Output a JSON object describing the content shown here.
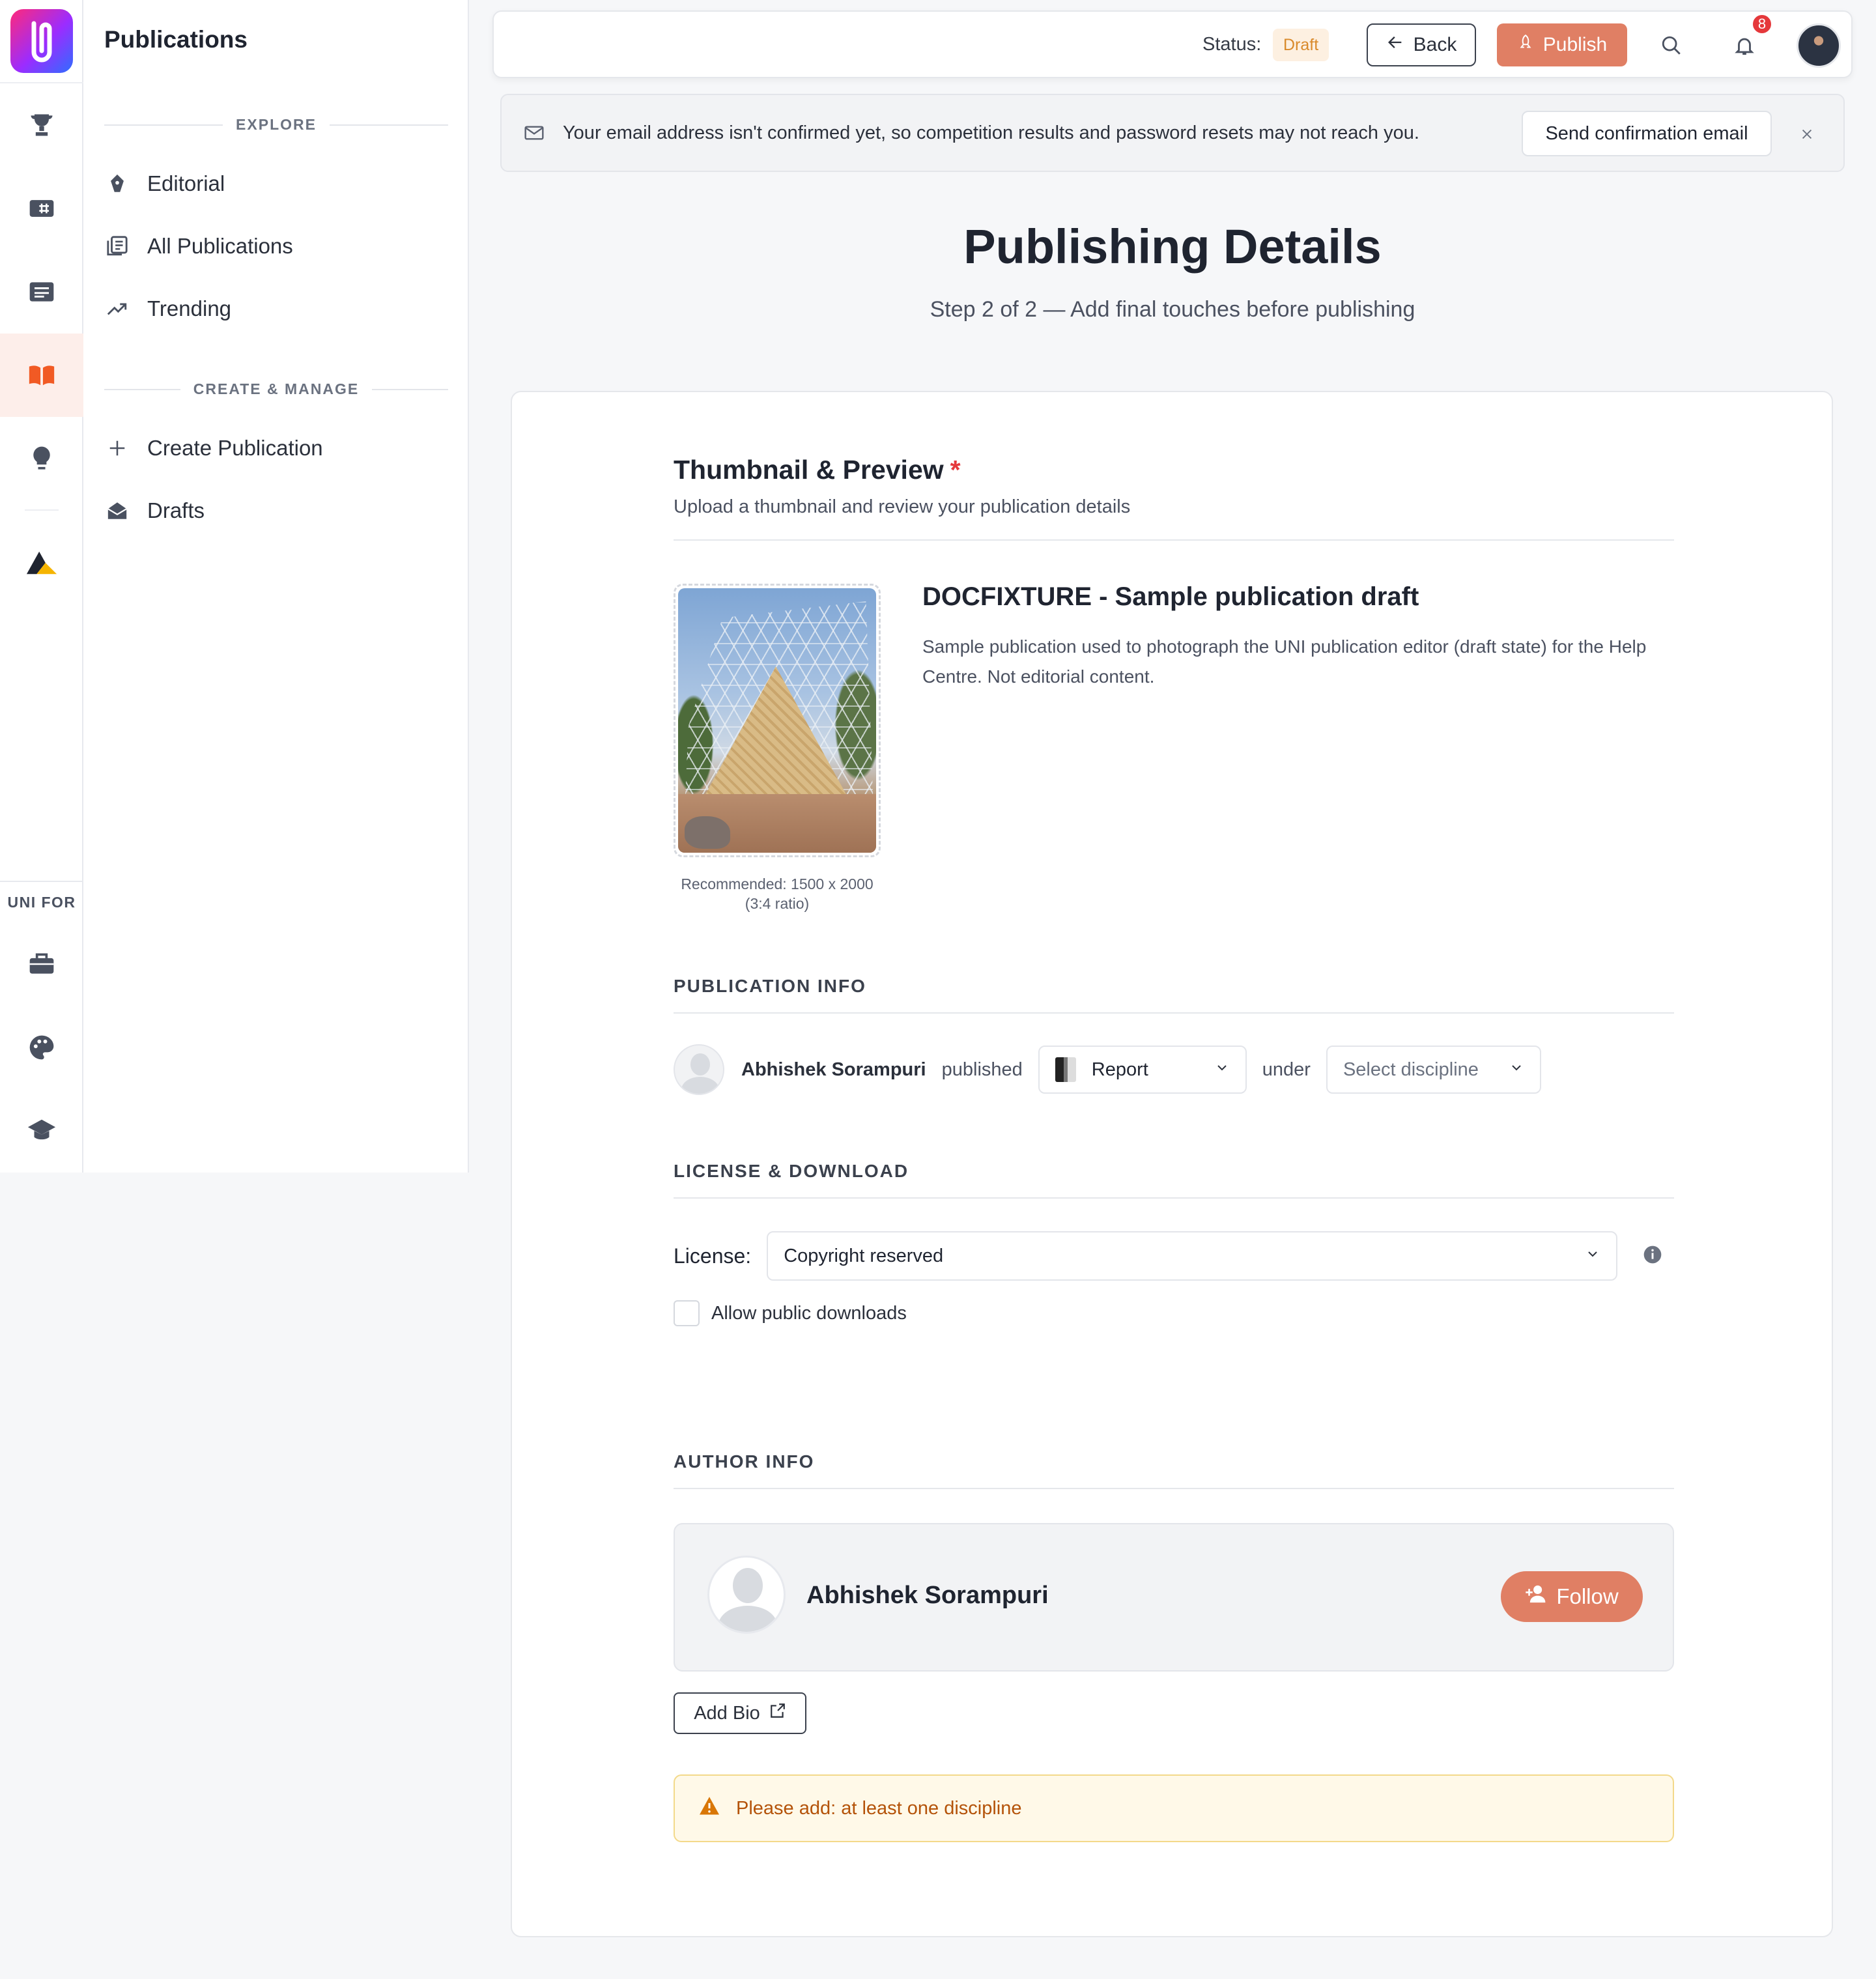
{
  "rail": {
    "uni_for_label": "UNI FOR"
  },
  "nav": {
    "title": "Publications",
    "explore_label": "EXPLORE",
    "explore_items": [
      {
        "label": "Editorial",
        "icon": "pen-nib-icon"
      },
      {
        "label": "All Publications",
        "icon": "publications-icon"
      },
      {
        "label": "Trending",
        "icon": "trending-icon"
      }
    ],
    "manage_label": "CREATE & MANAGE",
    "manage_items": [
      {
        "label": "Create Publication",
        "icon": "plus-icon"
      },
      {
        "label": "Drafts",
        "icon": "envelope-open-icon"
      }
    ]
  },
  "topbar": {
    "status_label": "Status:",
    "status_value": "Draft",
    "back_label": "Back",
    "publish_label": "Publish",
    "notification_count": "8"
  },
  "banner": {
    "message": "Your email address isn't confirmed yet, so competition results and password resets may not reach you.",
    "send_label": "Send confirmation email"
  },
  "page": {
    "title": "Publishing Details",
    "subtitle": "Step 2 of 2 — Add final touches before publishing"
  },
  "thumbnail": {
    "title": "Thumbnail & Preview",
    "required_mark": "*",
    "subtitle": "Upload a thumbnail and review your publication details",
    "recommendation": "Recommended: 1500 x 2000 (3:4 ratio)"
  },
  "publication": {
    "title": "DOCFIXTURE - Sample publication draft",
    "description": "Sample publication used to photograph the UNI publication editor (draft state) for the Help Centre. Not editorial content."
  },
  "pub_info": {
    "heading": "PUBLICATION INFO",
    "author": "Abhishek Sorampuri",
    "published_word": "published",
    "type_value": "Report",
    "under_word": "under",
    "discipline_placeholder": "Select discipline"
  },
  "license": {
    "heading": "LICENSE & DOWNLOAD",
    "label": "License:",
    "value": "Copyright reserved",
    "allow_downloads_label": "Allow public downloads"
  },
  "author_info": {
    "heading": "AUTHOR INFO",
    "name": "Abhishek Sorampuri",
    "follow_label": "Follow",
    "add_bio_label": "Add Bio"
  },
  "warning": {
    "message": "Please add: at least one discipline"
  },
  "colors": {
    "accent": "#e07f64",
    "active_rail": "#f15a24",
    "warning_text": "#b45309"
  }
}
